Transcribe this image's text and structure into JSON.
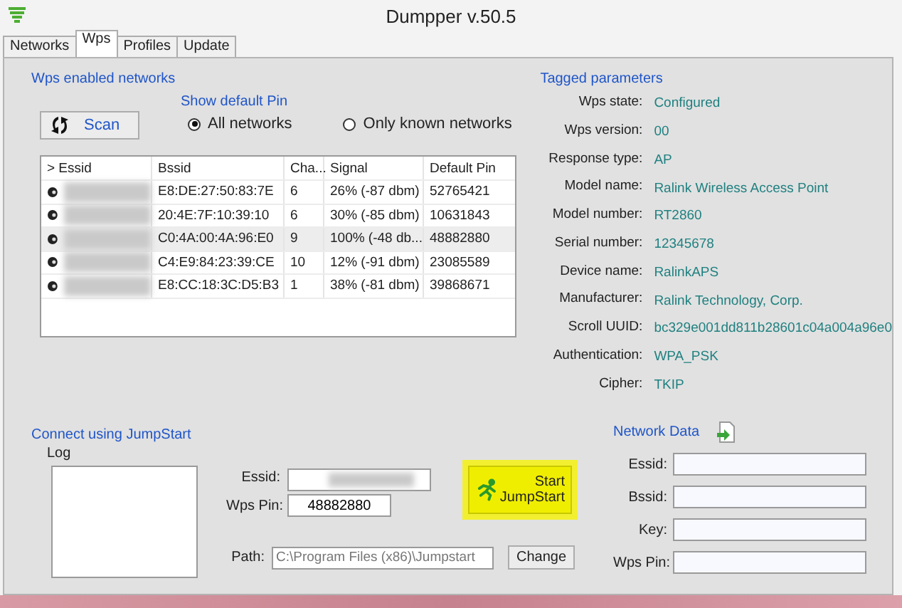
{
  "window": {
    "title": "Dumpper v.50.5"
  },
  "tabs": [
    {
      "label": "Networks",
      "selected": false
    },
    {
      "label": "Wps",
      "selected": true
    },
    {
      "label": "Profiles",
      "selected": false
    },
    {
      "label": "Update",
      "selected": false
    }
  ],
  "wps_networks": {
    "heading": "Wps enabled networks",
    "scan_button": "Scan",
    "show_default_pin": {
      "label": "Show default Pin",
      "options": [
        {
          "label": "All networks",
          "selected": true
        },
        {
          "label": "Only known networks",
          "selected": false
        }
      ]
    },
    "table": {
      "columns": [
        "> Essid",
        "Bssid",
        "Cha...",
        "Signal",
        "Default Pin"
      ],
      "rows": [
        {
          "essid_hidden": true,
          "bssid": "E8:DE:27:50:83:7E",
          "channel": "6",
          "signal": "26% (-87 dbm)",
          "default_pin": "52765421",
          "selected": false
        },
        {
          "essid_hidden": true,
          "bssid": "20:4E:7F:10:39:10",
          "channel": "6",
          "signal": "30% (-85 dbm)",
          "default_pin": "10631843",
          "selected": false
        },
        {
          "essid_hidden": true,
          "bssid": "C0:4A:00:4A:96:E0",
          "channel": "9",
          "signal": "100% (-48 db...",
          "default_pin": "48882880",
          "selected": true
        },
        {
          "essid_hidden": true,
          "bssid": "C4:E9:84:23:39:CE",
          "channel": "10",
          "signal": "12% (-91 dbm)",
          "default_pin": "23085589",
          "selected": false
        },
        {
          "essid_hidden": true,
          "bssid": "E8:CC:18:3C:D5:B3",
          "channel": "1",
          "signal": "38% (-81 dbm)",
          "default_pin": "39868671",
          "selected": false
        }
      ]
    }
  },
  "tagged_parameters": {
    "heading": "Tagged parameters",
    "rows": [
      {
        "label": "Wps state:",
        "value": "Configured"
      },
      {
        "label": "Wps version:",
        "value": "00"
      },
      {
        "label": "Response type:",
        "value": "AP"
      },
      {
        "label": "Model name:",
        "value": "Ralink Wireless Access Point"
      },
      {
        "label": "Model number:",
        "value": "RT2860"
      },
      {
        "label": "Serial number:",
        "value": "12345678"
      },
      {
        "label": "Device name:",
        "value": "RalinkAPS"
      },
      {
        "label": "Manufacturer:",
        "value": "Ralink Technology, Corp."
      },
      {
        "label": "Scroll UUID:",
        "value": "bc329e001dd811b28601c04a004a96e0"
      },
      {
        "label": "Authentication:",
        "value": "WPA_PSK"
      },
      {
        "label": "Cipher:",
        "value": "TKIP"
      }
    ]
  },
  "jumpstart": {
    "heading": "Connect using JumpStart",
    "log_label": "Log",
    "essid_label": "Essid:",
    "essid_hidden": true,
    "wps_pin_label": "Wps Pin:",
    "wps_pin": "48882880",
    "start_button": "Start\nJumpStart",
    "path_label": "Path:",
    "path": "C:\\Program Files (x86)\\Jumpstart",
    "change_button": "Change"
  },
  "network_data": {
    "heading": "Network Data",
    "fields": [
      {
        "label": "Essid:"
      },
      {
        "label": "Bssid:"
      },
      {
        "label": "Key:"
      },
      {
        "label": "Wps Pin:"
      }
    ]
  }
}
